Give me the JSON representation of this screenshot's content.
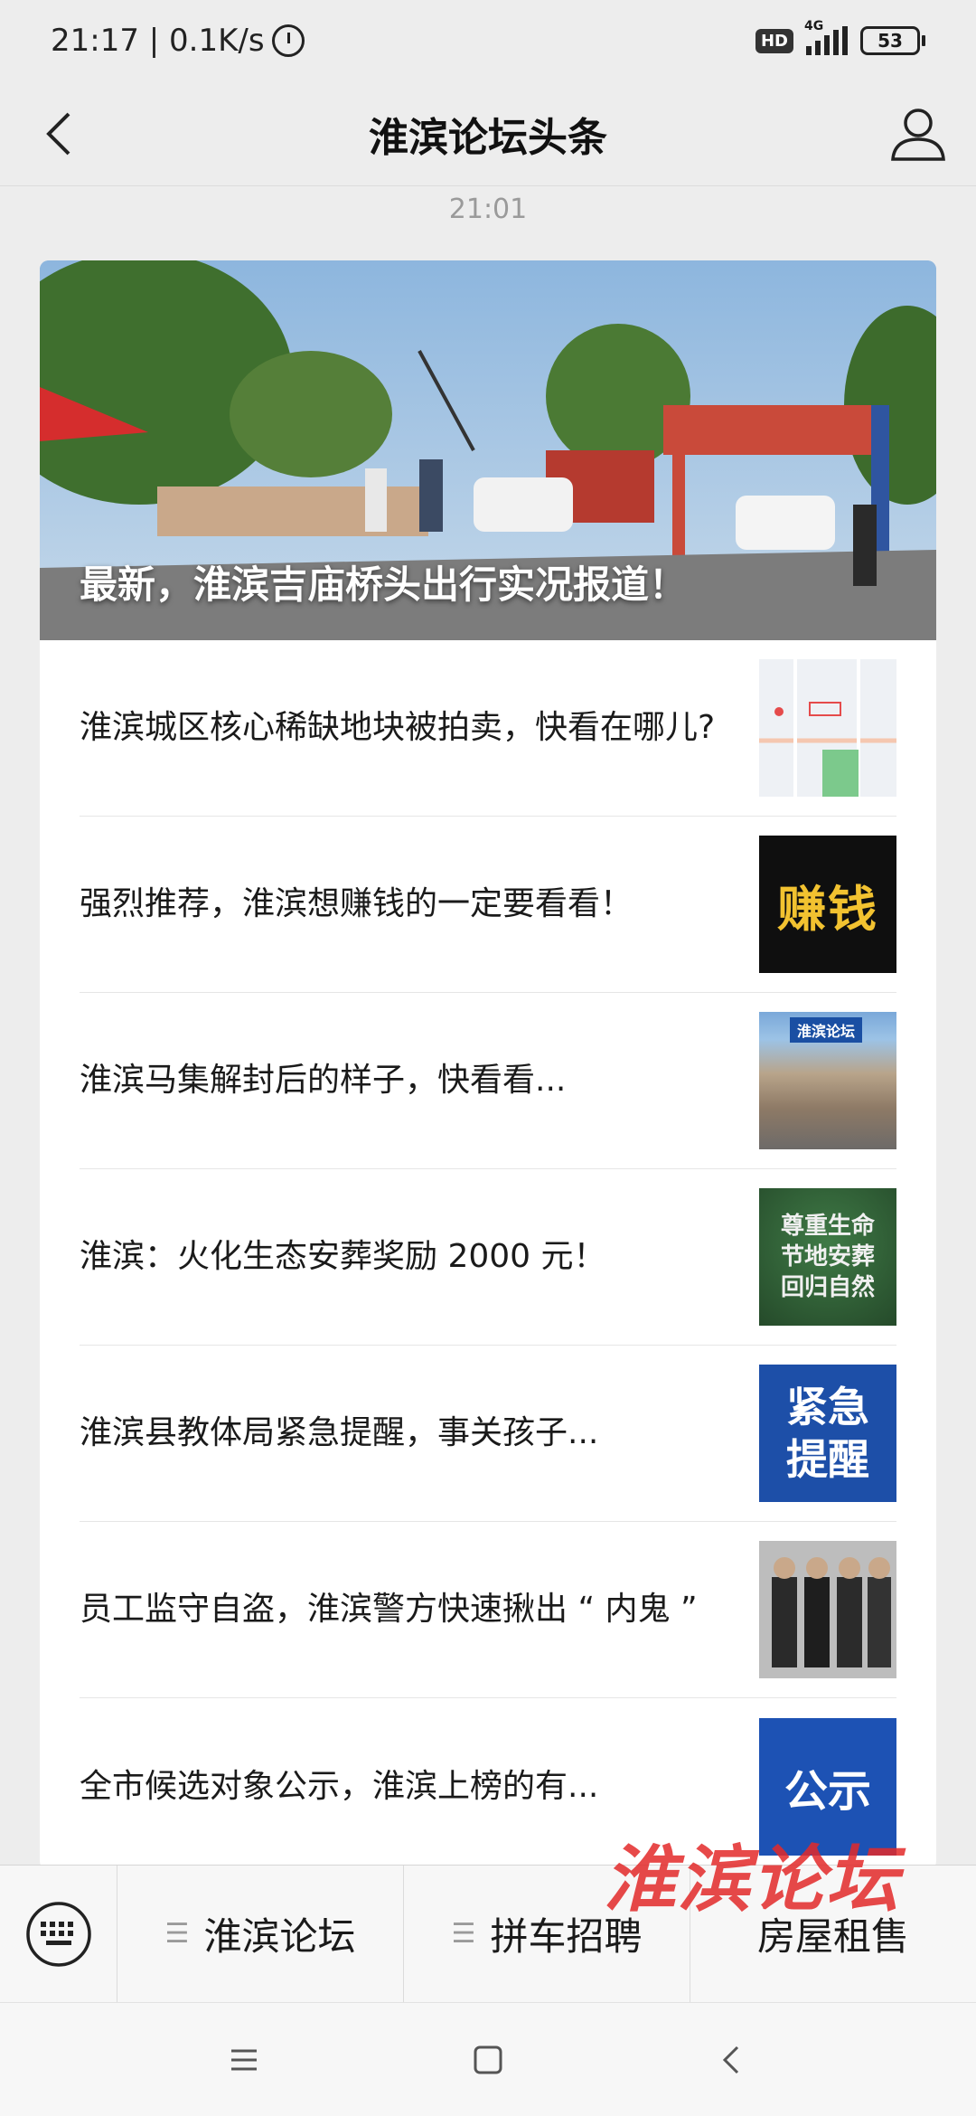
{
  "status_bar": {
    "time_speed": "21:17 | 0.1K/s",
    "hd": "HD",
    "network": "4G",
    "battery": "53"
  },
  "nav": {
    "title": "淮滨论坛头条"
  },
  "timestamp": "21:01",
  "cover": {
    "title": "最新，淮滨吉庙桥头出行实况报道！"
  },
  "articles": [
    {
      "title": "淮滨城区核心稀缺地块被拍卖，快看在哪儿?"
    },
    {
      "title": "强烈推荐，淮滨想赚钱的一定要看看！",
      "thumb_text": "赚钱"
    },
    {
      "title": "淮滨马集解封后的样子，快看看...",
      "thumb_text": "淮滨论坛"
    },
    {
      "title": "淮滨：火化生态安葬奖励 2000 元！",
      "thumb_lines": [
        "尊重生命",
        "节地安葬",
        "回归自然"
      ]
    },
    {
      "title": "淮滨县教体局紧急提醒，事关孩子...",
      "thumb_lines": [
        "紧急",
        "提醒"
      ]
    },
    {
      "title": "员工监守自盗，淮滨警方快速揪出 “ 内鬼 ”"
    },
    {
      "title": "全市候选对象公示，淮滨上榜的有...",
      "thumb_text": "公示"
    }
  ],
  "bottom_menu": {
    "items": [
      {
        "label": "淮滨论坛"
      },
      {
        "label": "拼车招聘"
      },
      {
        "label": "房屋租售"
      }
    ]
  },
  "watermark": "淮滨论坛"
}
